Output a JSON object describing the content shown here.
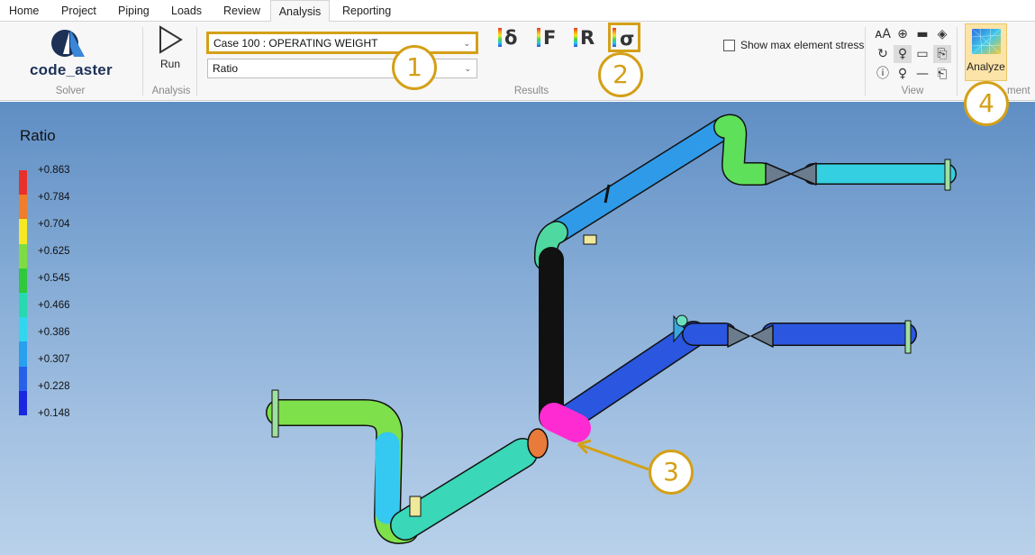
{
  "menu": {
    "tabs": [
      {
        "label": "Home"
      },
      {
        "label": "Project"
      },
      {
        "label": "Piping"
      },
      {
        "label": "Loads"
      },
      {
        "label": "Review"
      },
      {
        "label": "Analysis",
        "active": true
      },
      {
        "label": "Reporting"
      }
    ]
  },
  "ribbon": {
    "solver": {
      "logo_text": "code_aster",
      "group_label": "Solver"
    },
    "analysis": {
      "run_label": "Run",
      "group_label": "Analysis"
    },
    "results": {
      "case_value": "Case 100 : OPERATING WEIGHT",
      "quantity_value": "Ratio",
      "buttons": [
        "δ",
        "F",
        "R",
        "σ"
      ],
      "group_label": "Results"
    },
    "show_max_label": "Show max element stress",
    "view": {
      "group_label": "View"
    },
    "analyze": {
      "label": "Analyze",
      "group_label_partial": "ment"
    }
  },
  "callouts": [
    "1",
    "2",
    "3",
    "4"
  ],
  "colors": {
    "accent": "#d4a017",
    "active_tab_bg": "#f7f7f7"
  },
  "legend": {
    "title": "Ratio",
    "values": [
      "+0.863",
      "+0.784",
      "+0.704",
      "+0.625",
      "+0.545",
      "+0.466",
      "+0.386",
      "+0.307",
      "+0.228",
      "+0.148"
    ],
    "colors": [
      "#e8312c",
      "#f07d2a",
      "#f6e823",
      "#7ddc44",
      "#30c83d",
      "#27d9b0",
      "#31d7ef",
      "#28a0ee",
      "#2860e8",
      "#1a27e0"
    ]
  }
}
